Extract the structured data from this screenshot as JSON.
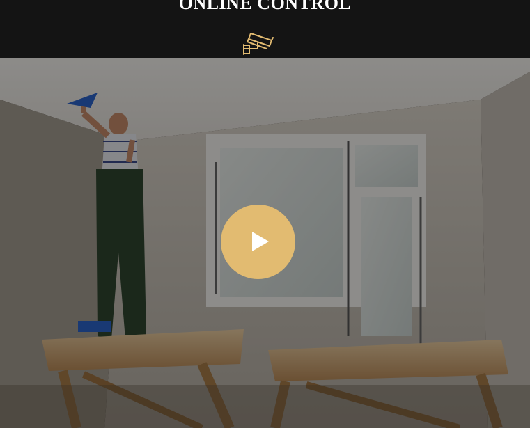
{
  "section": {
    "title": "ONLINE CONTROL",
    "icon": "security-camera-icon"
  },
  "video": {
    "play_icon": "play-icon",
    "accent_color": "#e2bb71"
  }
}
